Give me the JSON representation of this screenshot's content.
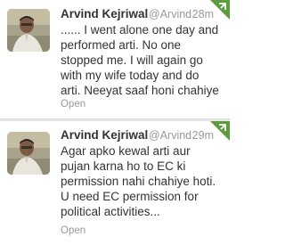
{
  "tweets": [
    {
      "name": "Arvind Kejriwal",
      "handle": "@ArvindKejriwal",
      "time": "28m",
      "text": "...... I went alone one day and performed arti. No one stopped me. I will again go with my wife today and do arti. Neeyat saaf honi chahiye",
      "open_label": "Open",
      "avatar_icon": "profile-photo",
      "corner_icon": "retweet-corner-icon"
    },
    {
      "name": "Arvind Kejriwal",
      "handle": "@ArvindKejriwal",
      "time": "29m",
      "text": "Agar apko kewal arti aur pujan karna ho to EC ki permission nahi chahiye hoti. U need EC permission for political activities...",
      "open_label": "Open",
      "avatar_icon": "profile-photo",
      "corner_icon": "retweet-corner-icon"
    }
  ],
  "colors": {
    "text": "#333333",
    "meta": "#999999",
    "retweet_green": "#5c9d3a",
    "divider": "#e6e6e6"
  }
}
